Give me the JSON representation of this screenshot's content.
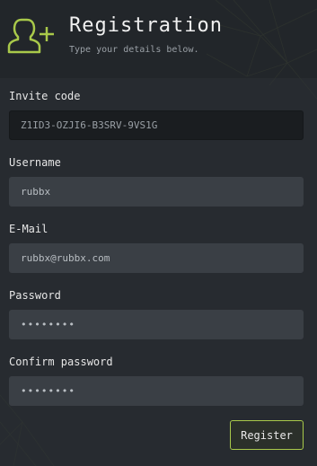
{
  "header": {
    "title": "Registration",
    "subtitle": "Type your details below.",
    "icon": "add-user-icon",
    "accent_color": "#a9c94a"
  },
  "form": {
    "invite_code": {
      "label": "Invite code",
      "value": "Z1ID3-OZJI6-B3SRV-9VS1G"
    },
    "username": {
      "label": "Username",
      "value": "rubbx"
    },
    "email": {
      "label": "E-Mail",
      "value": "rubbx@rubbx.com"
    },
    "password": {
      "label": "Password",
      "value": "••••••••"
    },
    "confirm_password": {
      "label": "Confirm password",
      "value": "••••••••"
    },
    "submit_label": "Register"
  }
}
